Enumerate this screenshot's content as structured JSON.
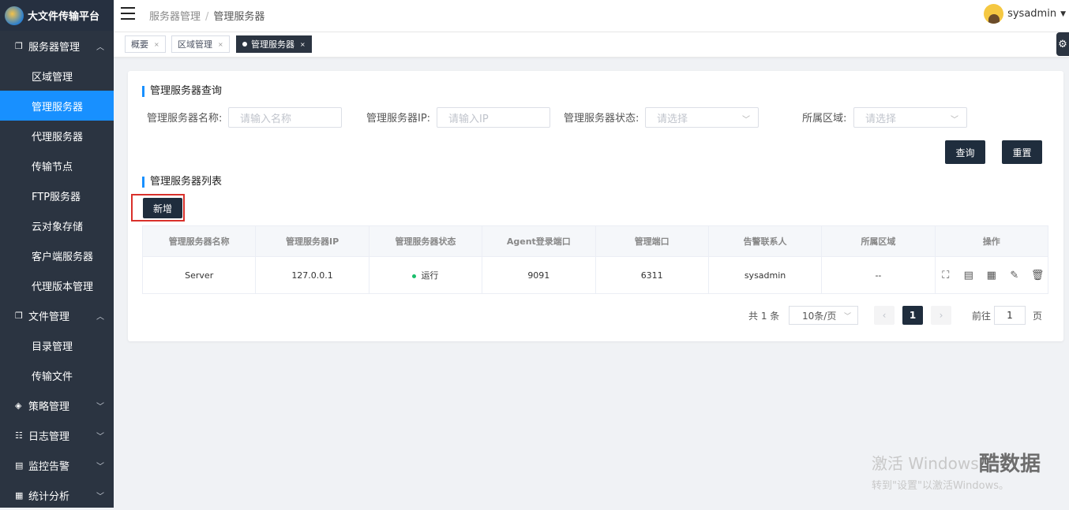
{
  "app": {
    "title": "大文件传输平台"
  },
  "sidebar": {
    "groups": [
      {
        "label": "服务器管理",
        "expanded": true,
        "items": [
          "区域管理",
          "管理服务器",
          "代理服务器",
          "传输节点",
          "FTP服务器",
          "云对象存储",
          "客户端服务器",
          "代理版本管理"
        ]
      },
      {
        "label": "文件管理",
        "expanded": true,
        "items": [
          "目录管理",
          "传输文件"
        ]
      },
      {
        "label": "策略管理",
        "expanded": false,
        "items": []
      },
      {
        "label": "日志管理",
        "expanded": false,
        "items": []
      },
      {
        "label": "监控告警",
        "expanded": false,
        "items": []
      },
      {
        "label": "统计分析",
        "expanded": false,
        "items": []
      }
    ],
    "active_item": "管理服务器"
  },
  "header": {
    "breadcrumb": [
      "服务器管理",
      "管理服务器"
    ],
    "user": "sysadmin"
  },
  "tabs": [
    {
      "label": "概要",
      "active": false
    },
    {
      "label": "区域管理",
      "active": false
    },
    {
      "label": "管理服务器",
      "active": true
    }
  ],
  "query": {
    "title": "管理服务器查询",
    "fields": [
      {
        "label": "管理服务器名称:",
        "placeholder": "请输入名称",
        "type": "input"
      },
      {
        "label": "管理服务器IP:",
        "placeholder": "请输入IP",
        "type": "input"
      },
      {
        "label": "管理服务器状态:",
        "placeholder": "请选择",
        "type": "select"
      },
      {
        "label": "所属区域:",
        "placeholder": "请选择",
        "type": "select"
      }
    ],
    "search_label": "查询",
    "reset_label": "重置"
  },
  "list": {
    "title": "管理服务器列表",
    "add_label": "新增",
    "columns": [
      "管理服务器名称",
      "管理服务器IP",
      "管理服务器状态",
      "Agent登录端口",
      "管理端口",
      "告警联系人",
      "所属区域",
      "操作"
    ],
    "rows": [
      {
        "name": "Server",
        "ip": "127.0.0.1",
        "status": "运行",
        "agent_port": "9091",
        "mgmt_port": "6311",
        "contact": "sysadmin",
        "region": "--"
      }
    ],
    "status_color": "#19be6b"
  },
  "pagination": {
    "total_text": "共 1 条",
    "page_size": "10条/页",
    "current_page": "1",
    "goto_label": "前往",
    "goto_value": "1",
    "page_suffix": "页"
  },
  "watermark": {
    "line1": "激活 Windows",
    "line2": "转到\"设置\"以激活Windows。",
    "brand": "酷数据"
  },
  "colors": {
    "sidebar_bg": "#2b3441",
    "accent": "#1890ff",
    "dark_button": "#1f2d3d",
    "highlight": "#d9312b"
  }
}
